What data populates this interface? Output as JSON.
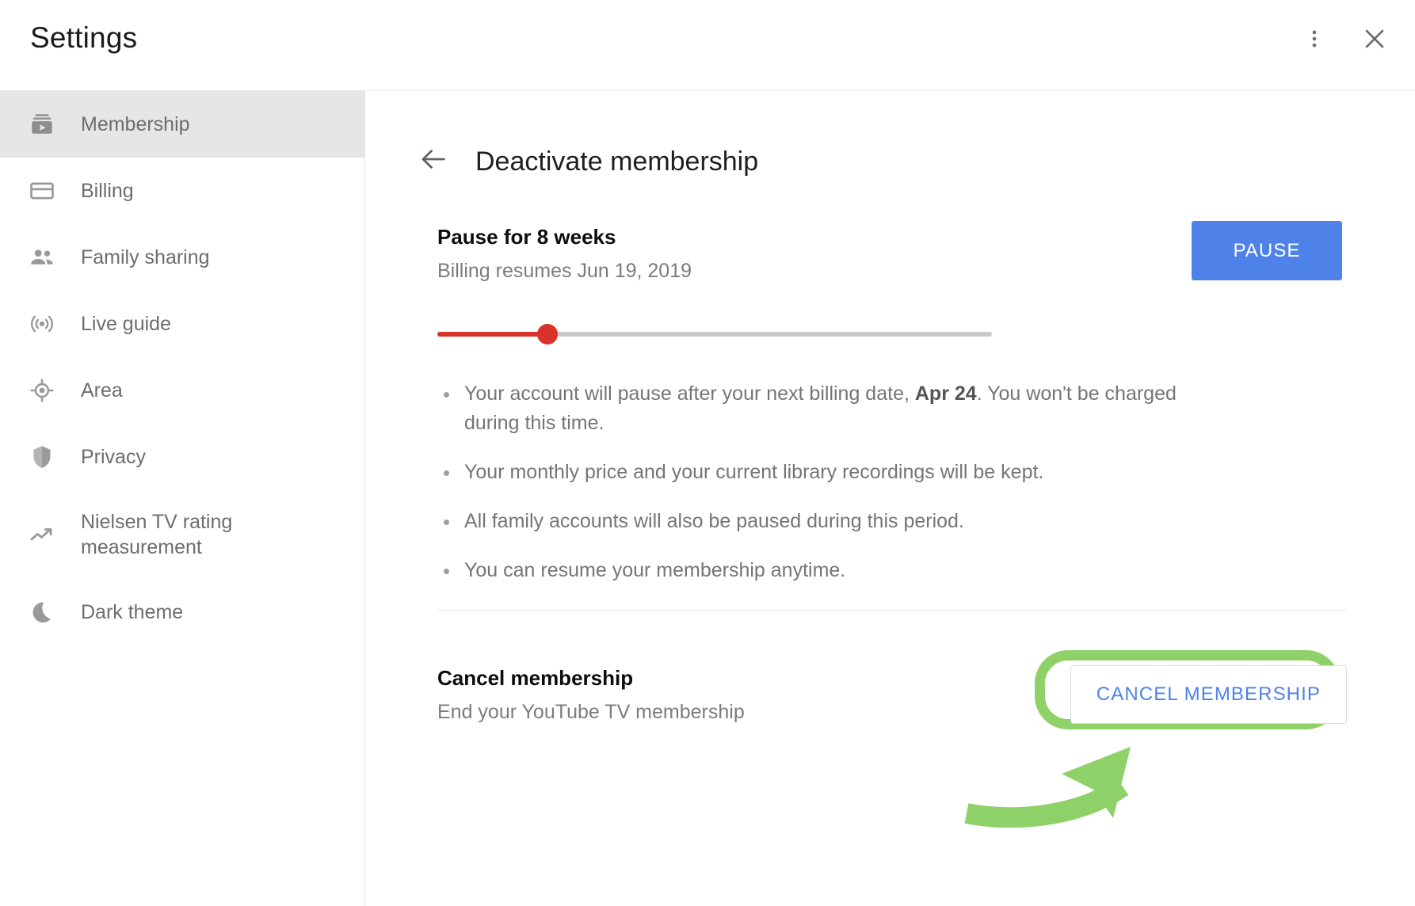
{
  "window": {
    "title": "Settings",
    "more_icon": "more-vert-icon",
    "close_icon": "close-icon"
  },
  "sidebar": {
    "items": [
      {
        "label": "Membership",
        "icon": "subscriptions-icon",
        "selected": true
      },
      {
        "label": "Billing",
        "icon": "credit-card-icon",
        "selected": false
      },
      {
        "label": "Family sharing",
        "icon": "people-icon",
        "selected": false
      },
      {
        "label": "Live guide",
        "icon": "live-broadcast-icon",
        "selected": false
      },
      {
        "label": "Area",
        "icon": "location-crosshair-icon",
        "selected": false
      },
      {
        "label": "Privacy",
        "icon": "shield-icon",
        "selected": false
      },
      {
        "label": "Nielsen TV rating measurement",
        "icon": "trending-up-icon",
        "selected": false
      },
      {
        "label": "Dark theme",
        "icon": "moon-icon",
        "selected": false
      }
    ]
  },
  "main": {
    "back_icon": "back-arrow-icon",
    "title": "Deactivate membership",
    "pause": {
      "title": "Pause for 8 weeks",
      "subtitle": "Billing resumes Jun 19, 2019",
      "button_label": "PAUSE",
      "slider": {
        "value_weeks": 8,
        "min_weeks": 0,
        "max_weeks": 40,
        "fill_percent": 20
      },
      "bullets": [
        {
          "text_before": "Your account will pause after your next billing date, ",
          "bold": "Apr 24",
          "text_after": ". You won't be charged during this time."
        },
        {
          "text_before": "Your monthly price and your current library recordings will be kept.",
          "bold": "",
          "text_after": ""
        },
        {
          "text_before": "All family accounts will also be paused during this period.",
          "bold": "",
          "text_after": ""
        },
        {
          "text_before": "You can resume your membership anytime.",
          "bold": "",
          "text_after": ""
        }
      ]
    },
    "cancel": {
      "title": "Cancel membership",
      "subtitle": "End your YouTube TV membership",
      "button_label": "CANCEL MEMBERSHIP"
    }
  },
  "annotation": {
    "highlight_color": "#8fd169",
    "arrow_icon": "curved-arrow-up-right-icon"
  },
  "colors": {
    "primary_blue": "#4e82e8",
    "slider_red": "#d8332a",
    "selected_row": "#e6e6e6",
    "annotation_green": "#8fd169"
  }
}
